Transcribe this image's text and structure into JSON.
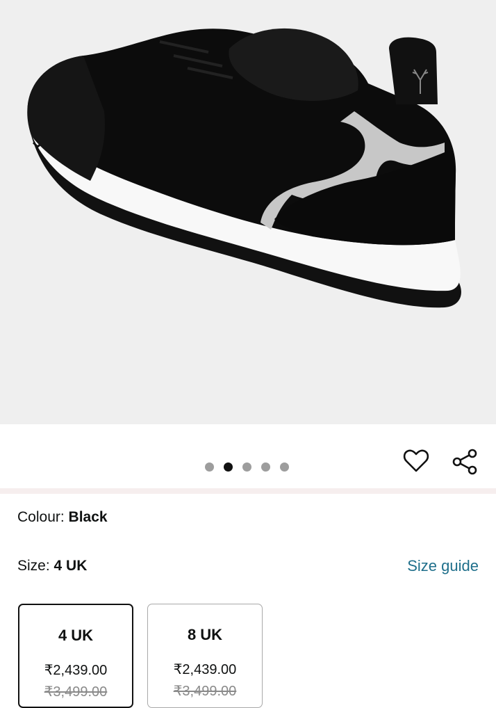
{
  "product_image": {
    "alt": "Black sneaker with white sole"
  },
  "carousel": {
    "total": 5,
    "active_index": 1
  },
  "actions": {
    "wishlist_icon": "heart-icon",
    "share_icon": "share-icon"
  },
  "colour": {
    "label": "Colour:",
    "value": "Black"
  },
  "size": {
    "label": "Size:",
    "value": "4 UK",
    "guide_label": "Size guide"
  },
  "size_options": [
    {
      "name": "4 UK",
      "price": "₹2,439.00",
      "mrp": "₹3,499.00",
      "selected": true
    },
    {
      "name": "8 UK",
      "price": "₹2,439.00",
      "mrp": "₹3,499.00",
      "selected": false
    }
  ],
  "colors": {
    "accent_link": "#1f6f8b",
    "image_bg": "#efefef",
    "dot_inactive": "#9d9d9d",
    "dot_active": "#111111"
  }
}
